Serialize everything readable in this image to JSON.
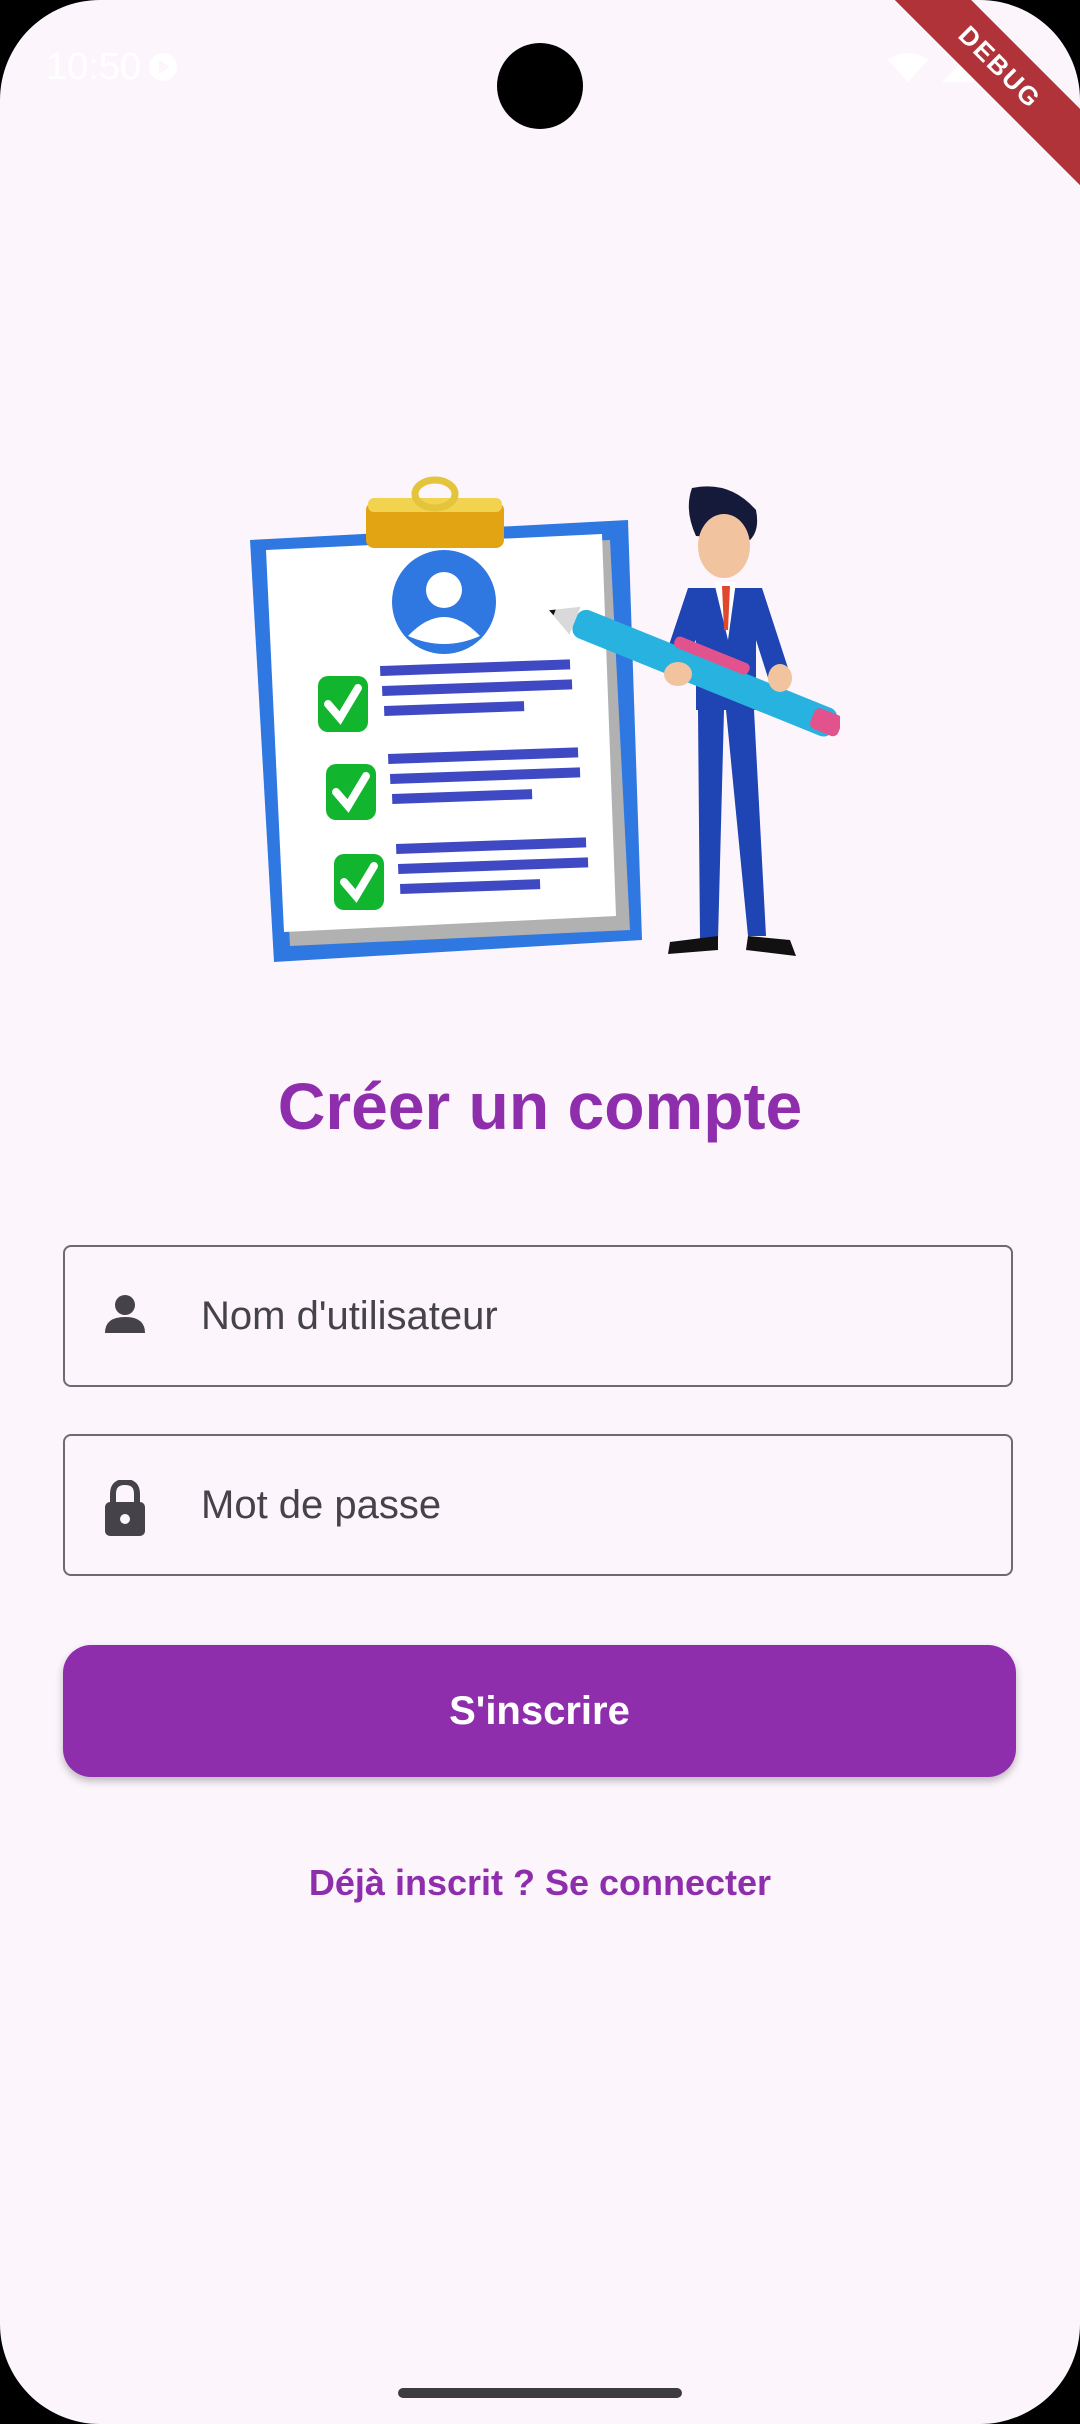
{
  "status_bar": {
    "time": "10:50",
    "icons": [
      "media-icon",
      "wifi-icon",
      "signal-icon",
      "battery-icon"
    ]
  },
  "debug_banner": "DEBUG",
  "hero_image": "clipboard-with-businessman-illustration",
  "title": "Créer un compte",
  "form": {
    "username": {
      "placeholder": "Nom d'utilisateur",
      "icon": "person-icon"
    },
    "password": {
      "placeholder": "Mot de passe",
      "icon": "lock-icon"
    }
  },
  "signup_button": "S'inscrire",
  "login_link": "Déjà inscrit ? Se connecter",
  "colors": {
    "primary": "#8e2eac",
    "background": "#fcf5fc",
    "border": "#6e6a72",
    "text": "#45424a"
  }
}
